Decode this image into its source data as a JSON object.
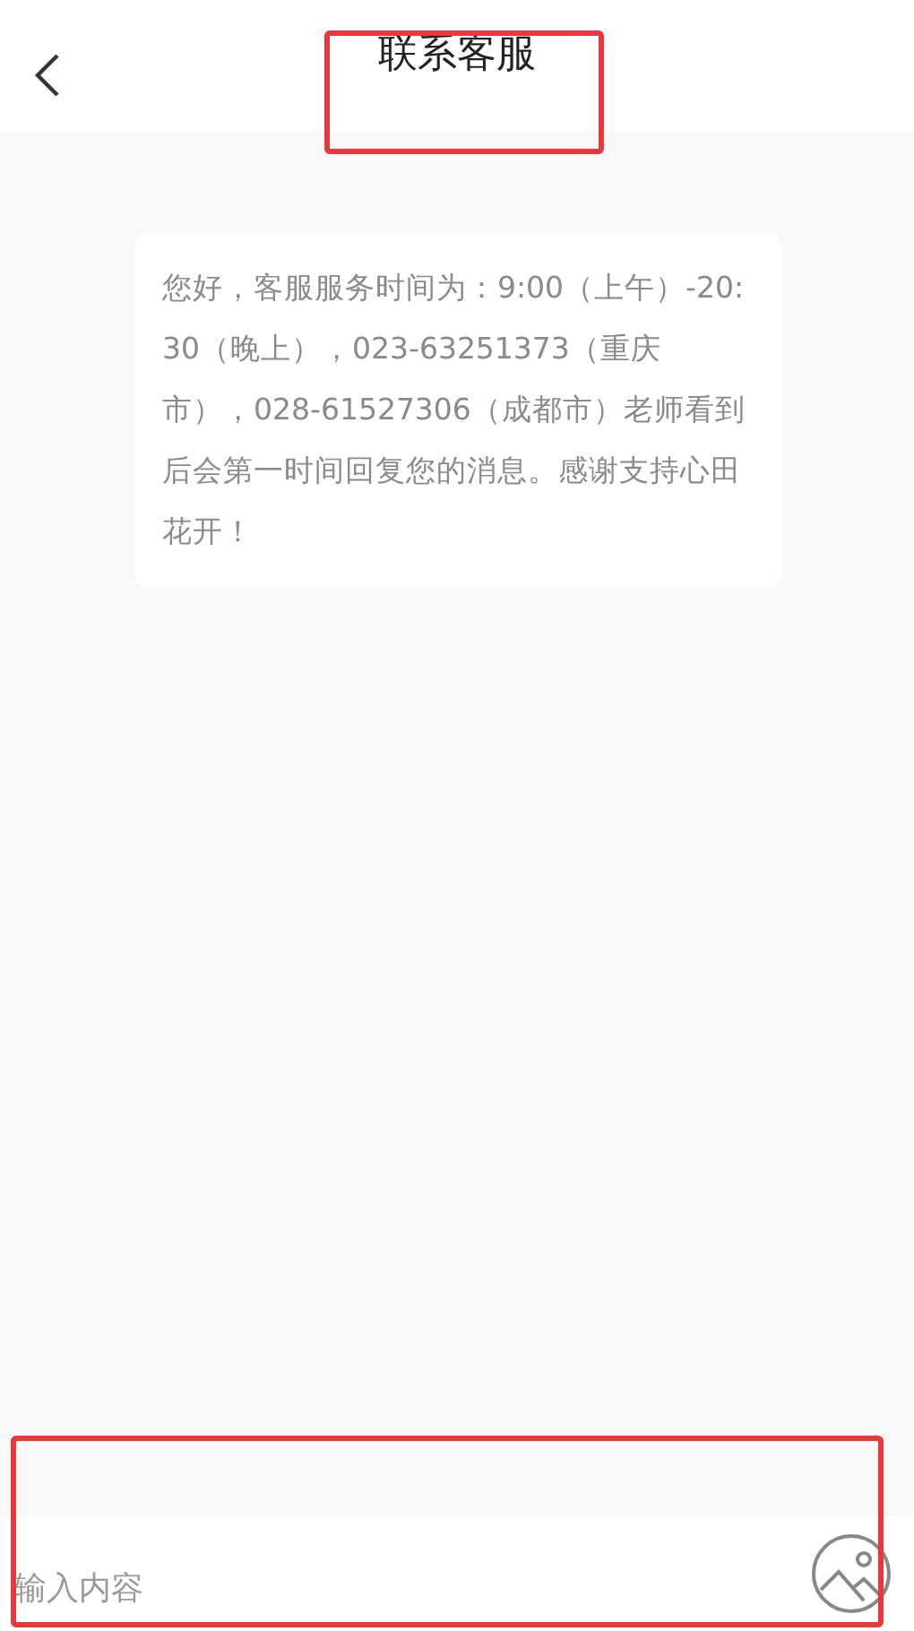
{
  "header": {
    "title": "联系客服"
  },
  "messages": [
    {
      "text": "您好，客服服务时间为：9:00（上午）-20:30（晚上），023-63251373（重庆市），028-61527306（成都市）老师看到后会第一时间回复您的消息。感谢支持心田花开！"
    }
  ],
  "composer": {
    "placeholder": "输入内容"
  }
}
